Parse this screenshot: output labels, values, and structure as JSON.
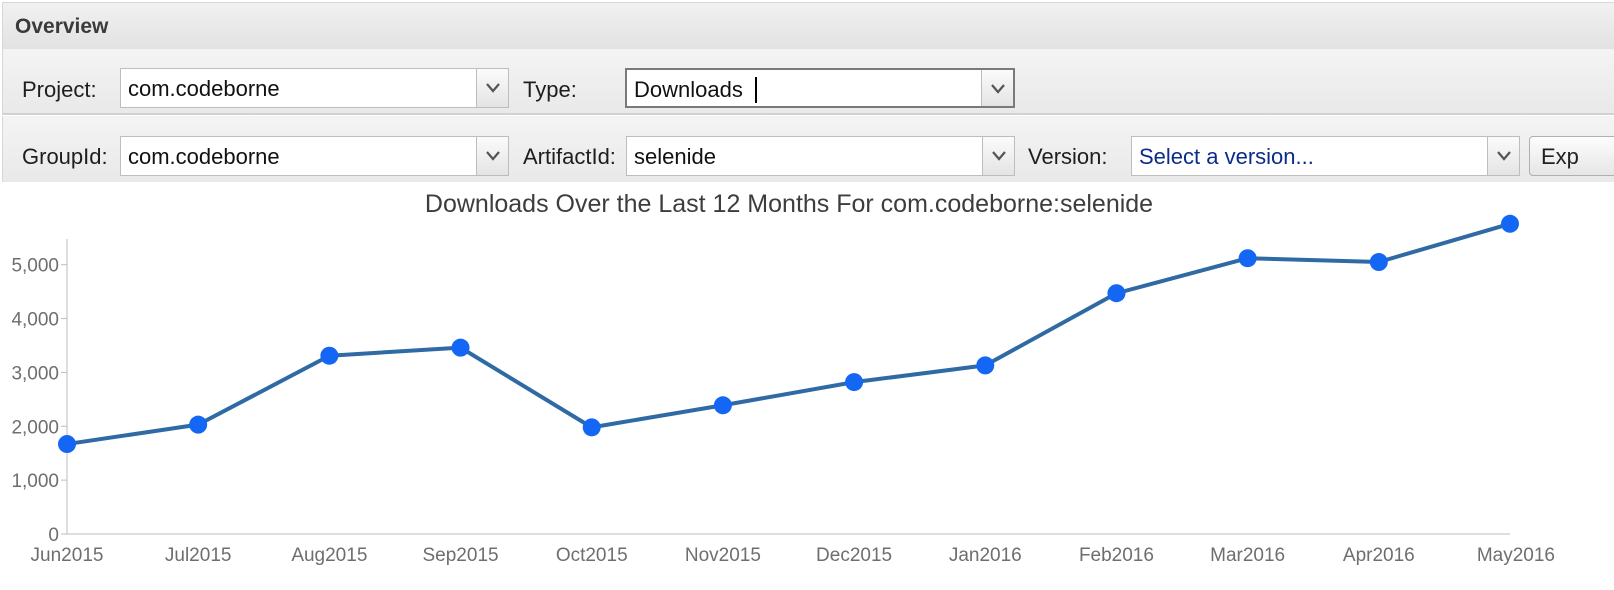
{
  "header": {
    "title": "Overview"
  },
  "row1": {
    "project_label": "Project:",
    "project_value": "com.codeborne",
    "type_label": "Type:",
    "type_value": "Downloads"
  },
  "row2": {
    "groupid_label": "GroupId:",
    "groupid_value": "com.codeborne",
    "artifactid_label": "ArtifactId:",
    "artifactid_value": "selenide",
    "version_label": "Version:",
    "version_placeholder": "Select a version...",
    "export_label": "Exp"
  },
  "colors": {
    "line": "#2f6aa5",
    "point": "#1467f5",
    "placeholder_text": "#0c2c8c"
  },
  "icons": {
    "dropdown": "chevron-down-icon"
  },
  "chart_data": {
    "type": "line",
    "title": "Downloads Over the Last 12 Months For com.codeborne:selenide",
    "categories": [
      "Jun2015",
      "Jul2015",
      "Aug2015",
      "Sep2015",
      "Oct2015",
      "Nov2015",
      "Dec2015",
      "Jan2016",
      "Feb2016",
      "Mar2016",
      "Apr2016",
      "May2016"
    ],
    "series": [
      {
        "values": [
          1670,
          2030,
          3310,
          3460,
          1980,
          2390,
          2820,
          3130,
          4470,
          5120,
          5050,
          5760
        ]
      }
    ],
    "yticks": [
      0,
      1000,
      2000,
      3000,
      4000,
      5000
    ],
    "ytick_labels": [
      "0",
      "1,000",
      "2,000",
      "3,000",
      "4,000",
      "5,000"
    ],
    "ylim": [
      0,
      5700
    ],
    "grid": false,
    "legend": "none"
  }
}
